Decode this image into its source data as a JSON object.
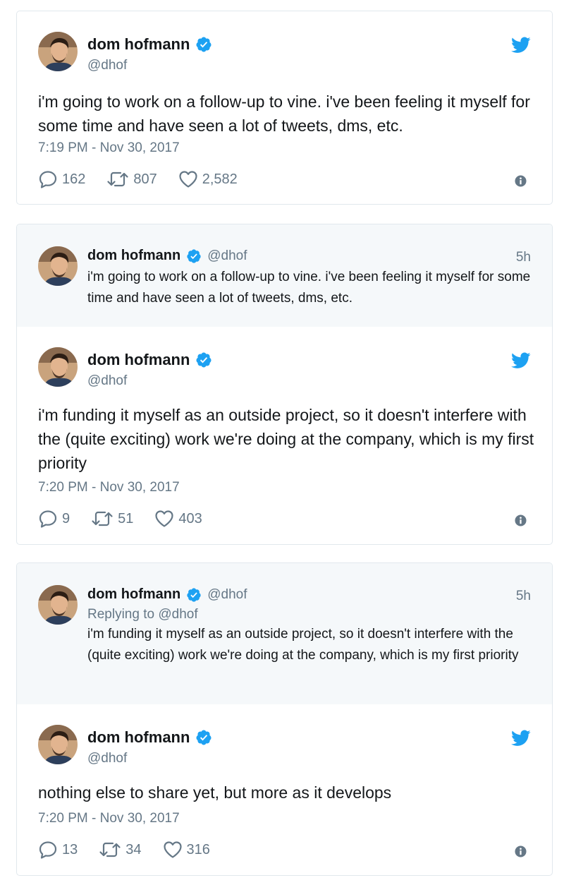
{
  "colors": {
    "twitter_blue": "#1da1f2",
    "muted": "#657786",
    "quoted_bg": "#f5f8fa",
    "border": "#e1e8ed"
  },
  "icons": [
    "twitter-bird-icon",
    "verified-badge-icon",
    "reply-icon",
    "retweet-icon",
    "like-icon",
    "info-icon"
  ],
  "tweets": [
    {
      "name": "dom hofmann",
      "handle": "@dhof",
      "text": "i'm going to work on a follow-up to vine. i've been feeling it myself for some time and have seen a lot of tweets, dms, etc.",
      "time": "7:19 PM - Nov 30, 2017",
      "replies": "162",
      "retweets": "807",
      "likes": "2,582"
    },
    {
      "quoted": {
        "name": "dom hofmann",
        "handle": "@dhof",
        "age": "5h",
        "text": "i'm going to work on a follow-up to vine. i've been feeling it myself for some time and have seen a lot of tweets, dms, etc."
      },
      "name": "dom hofmann",
      "handle": "@dhof",
      "text": "i'm funding it myself as an outside project, so it doesn't interfere with the (quite exciting) work we're doing at the company, which is my first priority",
      "time": "7:20 PM - Nov 30, 2017",
      "replies": "9",
      "retweets": "51",
      "likes": "403"
    },
    {
      "quoted": {
        "name": "dom hofmann",
        "handle": "@dhof",
        "age": "5h",
        "replying_to": "Replying to @dhof",
        "text": "i'm funding it myself as an outside project, so it doesn't interfere with the (quite exciting) work we're doing at the company, which is my first priority"
      },
      "name": "dom hofmann",
      "handle": "@dhof",
      "text": "nothing else to share yet, but more as it develops",
      "time": "7:20 PM - Nov 30, 2017",
      "replies": "13",
      "retweets": "34",
      "likes": "316"
    }
  ]
}
